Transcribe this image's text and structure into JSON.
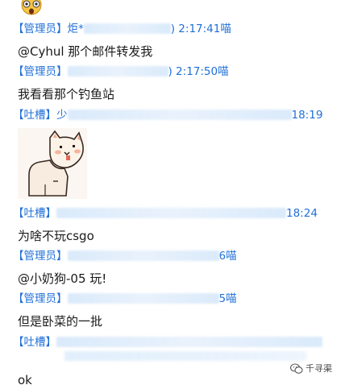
{
  "messages": [
    {
      "role": "【管理员】",
      "sender_visible": "炬*",
      "time": ") 2:17:41喵",
      "text": "@Cyhul 那个邮件转发我"
    },
    {
      "role": "【管理员】",
      "sender_visible": "",
      "time": ") 2:17:50喵",
      "text": "我看看那个钓鱼站"
    },
    {
      "role": "【吐槽】",
      "sender_visible": "少",
      "time": "18:19",
      "text": ""
    },
    {
      "role": "【吐槽】",
      "sender_visible": "",
      "time": "18:24",
      "text": "为啥不玩csgo"
    },
    {
      "role": "【管理员】",
      "sender_visible": "",
      "time": "6喵",
      "text": "@小奶狗-05 玩!"
    },
    {
      "role": "【管理员】",
      "sender_visible": "",
      "time": "5喵",
      "text": "但是卧菜的一批"
    },
    {
      "role": "【吐槽】",
      "sender_visible": "",
      "time": "",
      "text": "ok"
    }
  ],
  "sticker": {
    "icon": "cat-sticker-icon"
  },
  "top_emoji": {
    "icon": "shocked-face-emoji-icon"
  },
  "watermark": {
    "label": "千寻渠",
    "icon": "wechat-logo-icon"
  },
  "colors": {
    "meta": "#1f6fd8",
    "text": "#1a1a1a",
    "blur": "#d6e8fa"
  }
}
